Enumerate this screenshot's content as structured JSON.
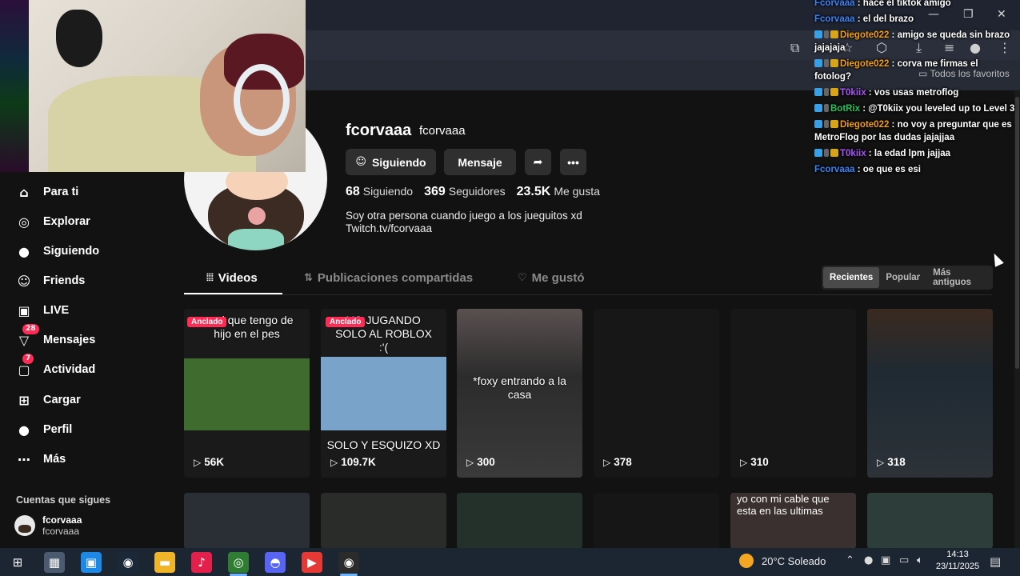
{
  "chat": [
    {
      "user": "Fcorvaaa",
      "color": "#3b82f6",
      "msg": "hace el tiktok amigo",
      "badges": []
    },
    {
      "user": "Fcorvaaa",
      "color": "#3b82f6",
      "msg": "el del brazo",
      "badges": []
    },
    {
      "user": "Diegote022",
      "color": "#f59e0b",
      "msg": "amigo se queda sin brazo jajajaja",
      "badges": [
        "b-blue",
        "b-grey",
        "b-gold"
      ]
    },
    {
      "user": "Diegote022",
      "color": "#f59e0b",
      "msg": "corva me firmas el fotolog?",
      "badges": [
        "b-blue",
        "b-grey",
        "b-gold"
      ]
    },
    {
      "user": "T0kiix",
      "color": "#a855f7",
      "msg": "vos usas metroflog",
      "badges": [
        "b-blue",
        "b-grey",
        "b-gold"
      ]
    },
    {
      "user": "BotRix",
      "color": "#22c55e",
      "msg": "@T0kiix you leveled up to Level 3",
      "badges": [
        "b-blue",
        "b-grey"
      ]
    },
    {
      "user": "Diegote022",
      "color": "#f59e0b",
      "msg": "no voy a preguntar que es MetroFlog por las dudas jajajjaa",
      "badges": [
        "b-blue",
        "b-grey",
        "b-gold"
      ]
    },
    {
      "user": "T0kiix",
      "color": "#a855f7",
      "msg": "la edad lpm jajjaa",
      "badges": [
        "b-blue",
        "b-grey",
        "b-gold"
      ]
    },
    {
      "user": "Fcorvaaa",
      "color": "#3b82f6",
      "msg": "oe que es esi",
      "badges": []
    }
  ],
  "browser": {
    "favorites_folder": "Todos los favoritos"
  },
  "sidebar": {
    "items": [
      {
        "label": "Para ti",
        "icon": "home-icon",
        "glyph": "⌂"
      },
      {
        "label": "Explorar",
        "icon": "compass-icon",
        "glyph": "◎"
      },
      {
        "label": "Siguiendo",
        "icon": "following-avatar-icon",
        "glyph": "●"
      },
      {
        "label": "Friends",
        "icon": "friends-icon",
        "glyph": "☺"
      },
      {
        "label": "LIVE",
        "icon": "live-tv-icon",
        "glyph": "▣"
      },
      {
        "label": "Mensajes",
        "icon": "messages-icon",
        "glyph": "▽",
        "badge": "28"
      },
      {
        "label": "Actividad",
        "icon": "activity-icon",
        "glyph": "▢",
        "badge": "7"
      },
      {
        "label": "Cargar",
        "icon": "upload-icon",
        "glyph": "⊞"
      },
      {
        "label": "Perfil",
        "icon": "profile-avatar-icon",
        "glyph": "●"
      },
      {
        "label": "Más",
        "icon": "more-icon",
        "glyph": "⋯"
      }
    ],
    "following_title": "Cuentas que sigues",
    "following_account": {
      "name": "fcorvaaa",
      "handle": "fcorvaaa"
    }
  },
  "profile": {
    "username": "fcorvaaa",
    "nickname": "fcorvaaa",
    "follow_button": "Siguiendo",
    "message_button": "Mensaje",
    "stats": [
      {
        "value": "68",
        "label": "Siguiendo"
      },
      {
        "value": "369",
        "label": "Seguidores"
      },
      {
        "value": "23.5K",
        "label": "Me gusta"
      }
    ],
    "bio_line1": "Soy otra persona cuando juego a los jueguitos xd",
    "bio_line2": "Twitch.tv/fcorvaaa"
  },
  "tabs": [
    {
      "label": "Videos",
      "glyph": "⦙⦙⦙"
    },
    {
      "label": "Publicaciones compartidas",
      "glyph": "⇅"
    },
    {
      "label": "Me gustó",
      "glyph": "♡"
    }
  ],
  "sort": [
    "Recientes",
    "Popular",
    "Más antiguos"
  ],
  "videos": [
    {
      "views": "56K",
      "pinned": "Anclado",
      "caption": "pa al que tengo de hijo en el pes",
      "thumb": "#3f6b2e"
    },
    {
      "views": "109.7K",
      "pinned": "Anclado",
      "caption": "YO JUGANDO SOLO AL ROBLOX :'(",
      "caption2": "SOLO Y ESQUIZO XD",
      "thumb": "#7aa3c9"
    },
    {
      "views": "300",
      "caption": "*foxy entrando a la casa",
      "thumb": "#3b3b3b"
    },
    {
      "views": "378",
      "thumb": "#171717"
    },
    {
      "views": "310",
      "thumb": "#171717"
    },
    {
      "views": "318",
      "thumb": "#2a3138"
    }
  ],
  "videos_row2": [
    {
      "thumb": "#2a2f36"
    },
    {
      "thumb": "#2a2c2a"
    },
    {
      "thumb": "#24302a"
    },
    {
      "thumb": "#161616"
    },
    {
      "caption": "yo con mi cable que esta en las ultimas",
      "thumb": "#3a3030"
    },
    {
      "thumb": "#2d3d3a"
    }
  ],
  "taskbar": {
    "apps": [
      "windows-start-icon",
      "file-explorer-icon",
      "microsoft-store-icon",
      "steam-icon",
      "folder-icon",
      "tiktok-icon",
      "chrome-icon",
      "discord-icon",
      "media-player-icon",
      "obs-icon"
    ],
    "weather": "20°C  Soleado",
    "time": "14:13",
    "date": "23/11/2025"
  }
}
